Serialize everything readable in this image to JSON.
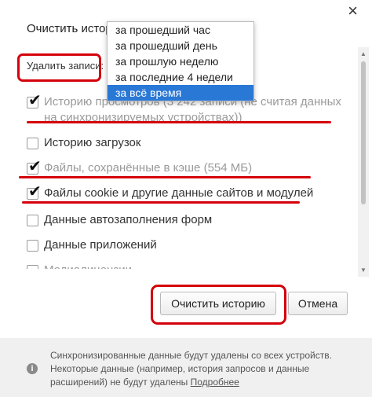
{
  "dialog": {
    "title": "Очистить историю",
    "close_label": "×",
    "delete_label": "Удалить записи:"
  },
  "period_dropdown": {
    "options": [
      "за прошедший час",
      "за прошедший день",
      "за прошлую неделю",
      "за последние 4 недели",
      "за всё время"
    ],
    "selected": "за всё время"
  },
  "items": [
    {
      "label": "Историю просмотров (3 242 записи (не считая данных",
      "label_line2": "на синхронизируемых устройствах))",
      "checked": true,
      "faded": true
    },
    {
      "label": "Историю загрузок",
      "checked": false,
      "faded": false
    },
    {
      "label": "Файлы, сохранённые в кэше (554 МБ)",
      "checked": true,
      "faded": true
    },
    {
      "label": "Файлы cookie и другие данные сайтов и модулей",
      "checked": true,
      "faded": false
    },
    {
      "label": "Данные автозаполнения форм",
      "checked": false,
      "faded": false
    },
    {
      "label": "Данные приложений",
      "checked": false,
      "faded": false
    },
    {
      "label": "Медиалицензии",
      "checked": false,
      "faded": true
    }
  ],
  "buttons": {
    "clear": "Очистить историю",
    "cancel": "Отмена"
  },
  "footer": {
    "text": "Синхронизированные данные будут удалены со всех устройств. Некоторые данные (например, история запросов и данные расширений) не будут удалены",
    "link": "Подробнее"
  },
  "colors": {
    "highlight_red": "#d4000b",
    "selected_blue": "#2a78d6"
  }
}
